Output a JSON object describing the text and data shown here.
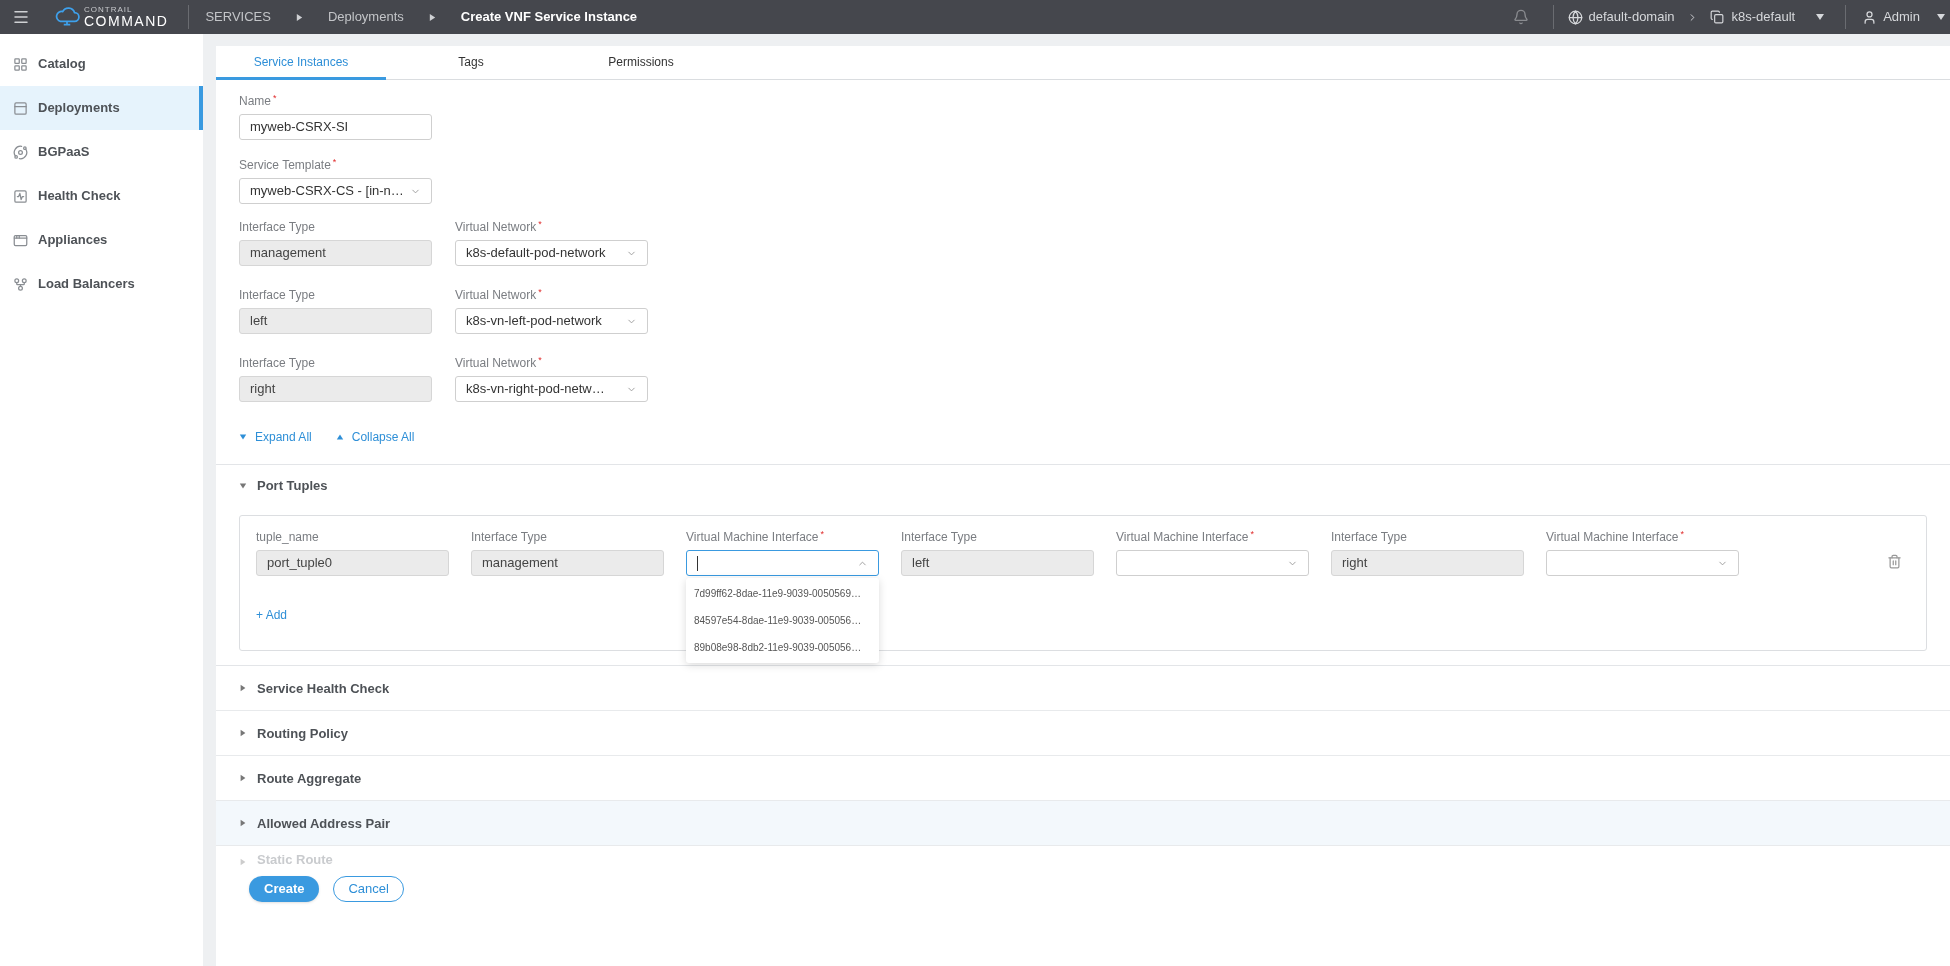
{
  "topbar": {
    "logo_top": "CONTRAIL",
    "logo_bottom": "COMMAND",
    "breadcrumbs": [
      {
        "label": "SERVICES",
        "current": false
      },
      {
        "label": "Deployments",
        "current": false
      },
      {
        "label": "Create VNF Service Instance",
        "current": true
      }
    ],
    "domain": "default-domain",
    "project": "k8s-default",
    "user": "Admin"
  },
  "sidebar": {
    "items": [
      {
        "label": "Catalog",
        "selected": false
      },
      {
        "label": "Deployments",
        "selected": true
      },
      {
        "label": "BGPaaS",
        "selected": false
      },
      {
        "label": "Health Check",
        "selected": false
      },
      {
        "label": "Appliances",
        "selected": false
      },
      {
        "label": "Load Balancers",
        "selected": false
      }
    ]
  },
  "tabs": [
    {
      "label": "Service Instances",
      "selected": true
    },
    {
      "label": "Tags",
      "selected": false
    },
    {
      "label": "Permissions",
      "selected": false
    }
  ],
  "form": {
    "name": {
      "label": "Name$^{*}$",
      "value": "myweb-CSRX-SI"
    },
    "service_template": {
      "label": "Service Template$^{*}$",
      "value": "myweb-CSRX-CS - [in-n…"
    },
    "interfaces": [
      {
        "type_label": "Interface Type",
        "type_value": "management",
        "network_label": "Virtual Network$^{*}$",
        "network_value": "k8s-default-pod-network"
      },
      {
        "type_label": "Interface Type",
        "type_value": "left",
        "network_label": "Virtual Network$^{*}$",
        "network_value": "k8s-vn-left-pod-network"
      },
      {
        "type_label": "Interface Type",
        "type_value": "right",
        "network_label": "Virtual Network$^{*}$",
        "network_value": "k8s-vn-right-pod-netw…"
      }
    ],
    "expand_all": "Expand All",
    "collapse_all": "Collapse All"
  },
  "port_tuples": {
    "title": "Port Tuples",
    "expanded": true,
    "fields": [
      {
        "label": "tuple_name",
        "kind": "readonly",
        "value": "port_tuple0"
      },
      {
        "label": "Interface Type",
        "kind": "readonly",
        "value": "management"
      },
      {
        "label": "Virtual Machine Interface$^{*}$",
        "kind": "select",
        "focused": true
      },
      {
        "label": "Interface Type",
        "kind": "readonly",
        "value": "left"
      },
      {
        "label": "Virtual Machine Interface$^{*}$",
        "kind": "select",
        "focused": false
      },
      {
        "label": "Interface Type",
        "kind": "readonly",
        "value": "right"
      },
      {
        "label": "Virtual Machine Interface$^{*}$",
        "kind": "select",
        "focused": false
      }
    ],
    "dropdown_options": [
      "7d99ff62-8dae-11e9-9039-0050569…",
      "84597e54-8dae-11e9-9039-005056…",
      "89b08e98-8db2-11e9-9039-005056…"
    ],
    "add": "+ Add"
  },
  "sections": [
    {
      "title": "Service Health Check",
      "highlighted": false,
      "faded": false
    },
    {
      "title": "Routing Policy",
      "highlighted": false,
      "faded": false
    },
    {
      "title": "Route Aggregate",
      "highlighted": false,
      "faded": false
    },
    {
      "title": "Allowed Address Pair",
      "highlighted": true,
      "faded": false
    },
    {
      "title": "Static Route",
      "highlighted": false,
      "faded": true
    }
  ],
  "buttons": {
    "create": "Create",
    "cancel": "Cancel"
  }
}
